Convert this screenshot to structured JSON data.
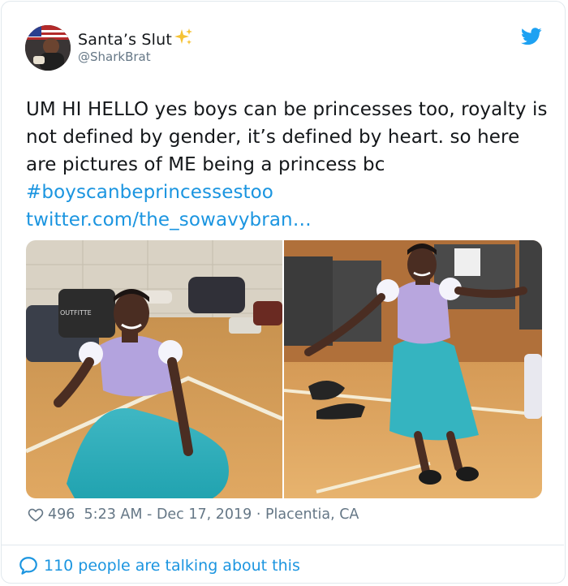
{
  "user": {
    "display_name": "Santa’s Slut",
    "handle": "@SharkBrat"
  },
  "tweet": {
    "text_main": "UM HI HELLO yes boys can be princesses too, royalty is not defined by gender, it’s defined by heart. so here are pictures of ME being a princess bc",
    "hashtag": "#boyscanbeprincessestoo",
    "link": "twitter.com/the_sowavybran…"
  },
  "meta": {
    "likes": "496",
    "time": "5:23 AM",
    "separator": " - ",
    "date": "Dec 17, 2019",
    "dot": " · ",
    "location": "Placentia, CA"
  },
  "footer": {
    "talk_text": "110 people are talking about this"
  },
  "media": {
    "left_bag_text": "OUTFITTE"
  },
  "colors": {
    "accent": "#1b95e0",
    "muted": "#657786",
    "text": "#14171a"
  }
}
